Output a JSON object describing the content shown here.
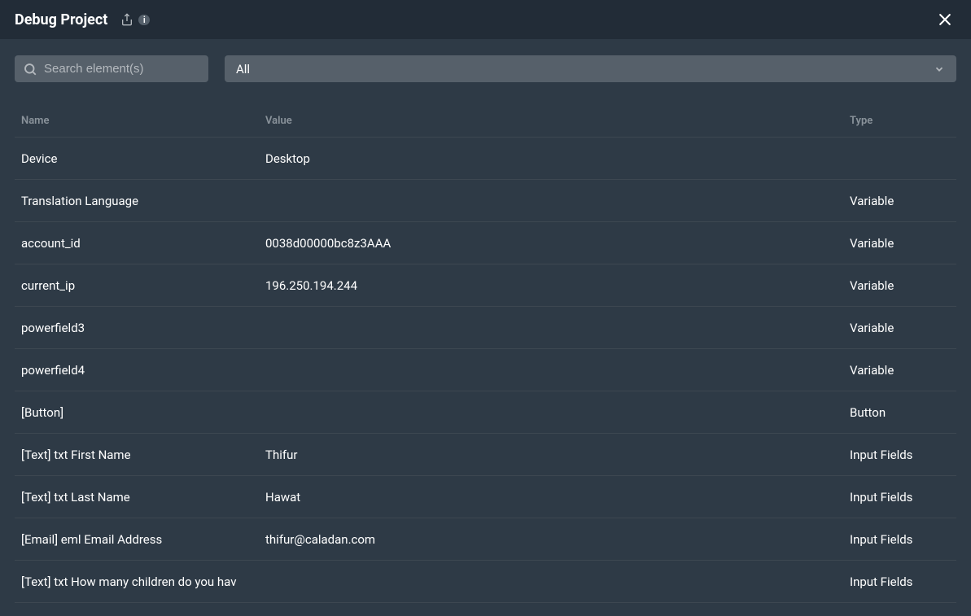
{
  "titlebar": {
    "title": "Debug Project",
    "badge": "i"
  },
  "toolbar": {
    "search_placeholder": "Search element(s)",
    "filter_selected": "All"
  },
  "table": {
    "headers": {
      "name": "Name",
      "value": "Value",
      "type": "Type"
    },
    "rows": [
      {
        "name": "Device",
        "value": "Desktop",
        "type": ""
      },
      {
        "name": "Translation Language",
        "value": "",
        "type": "Variable"
      },
      {
        "name": "account_id",
        "value": "0038d00000bc8z3AAA",
        "type": "Variable"
      },
      {
        "name": "current_ip",
        "value": "196.250.194.244",
        "type": "Variable"
      },
      {
        "name": "powerfield3",
        "value": "",
        "type": "Variable"
      },
      {
        "name": "powerfield4",
        "value": "",
        "type": "Variable"
      },
      {
        "name": "[Button]",
        "value": "",
        "type": "Button"
      },
      {
        "name": "[Text] txt First Name",
        "value": "Thifur",
        "type": "Input Fields"
      },
      {
        "name": "[Text] txt Last Name",
        "value": "Hawat",
        "type": "Input Fields"
      },
      {
        "name": "[Email] eml Email Address",
        "value": "thifur@caladan.com",
        "type": "Input Fields"
      },
      {
        "name": "[Text] txt How many children do you hav",
        "value": "",
        "type": "Input Fields"
      }
    ]
  }
}
